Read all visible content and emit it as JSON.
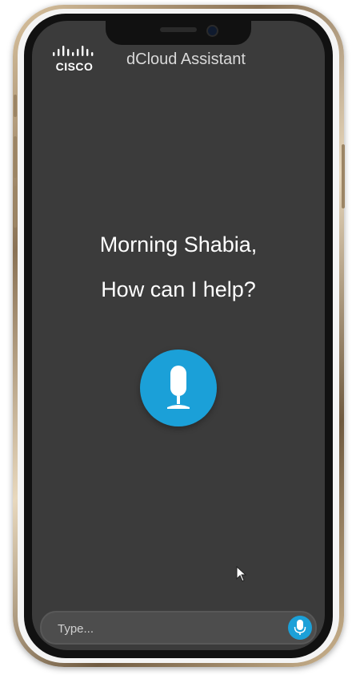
{
  "header": {
    "logo_text": "CISCO",
    "app_title": "dCloud Assistant"
  },
  "main": {
    "greeting_line1": "Morning Shabia,",
    "greeting_line2": "How can I help?"
  },
  "input": {
    "placeholder": "Type...",
    "value": ""
  },
  "icons": {
    "voice_button": "microphone-icon",
    "send_voice": "microphone-icon",
    "cursor": "mouse-pointer-icon"
  },
  "colors": {
    "screen_bg": "#3b3b3b",
    "accent": "#1ba0d8",
    "text": "#ffffff"
  }
}
